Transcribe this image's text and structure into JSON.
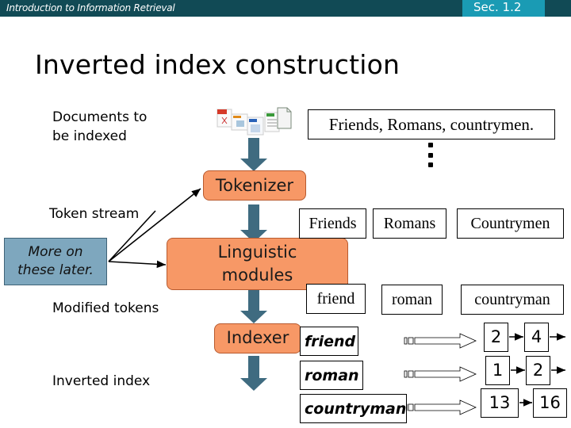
{
  "header": {
    "course": "Introduction to Information Retrieval",
    "section": "Sec. 1.2",
    "bar_color": "#114a55",
    "section_color": "#1a9bb4"
  },
  "title": "Inverted index construction",
  "left_labels": {
    "documents_line1": "Documents to",
    "documents_line2": "be indexed",
    "token_stream": "Token stream",
    "modified_tokens": "Modified tokens",
    "inverted_index": "Inverted index"
  },
  "note": {
    "line1": "More on",
    "line2": "these later.",
    "color": "#7ea7be"
  },
  "documents": {
    "icons": [
      "pdf-file-icon",
      "html-file-icon",
      "doc-file-icon",
      "spreadsheet-file-icon",
      "blank-file-icon"
    ],
    "sample_text": "Friends, Romans, countrymen.",
    "ellipsis": "⋮"
  },
  "stages": {
    "tokenizer": "Tokenizer",
    "linguistic_line1": "Linguistic",
    "linguistic_line2": "modules",
    "indexer": "Indexer",
    "color": "#f79866"
  },
  "tokens": [
    "Friends",
    "Romans",
    "Countrymen"
  ],
  "modified_tokens": [
    "friend",
    "roman",
    "countryman"
  ],
  "index": [
    {
      "term": "friend",
      "postings": [
        "2",
        "4"
      ],
      "more": true
    },
    {
      "term": "roman",
      "postings": [
        "1",
        "2"
      ],
      "more": true
    },
    {
      "term": "countryman",
      "postings": [
        "13",
        "16"
      ],
      "more": false
    }
  ]
}
